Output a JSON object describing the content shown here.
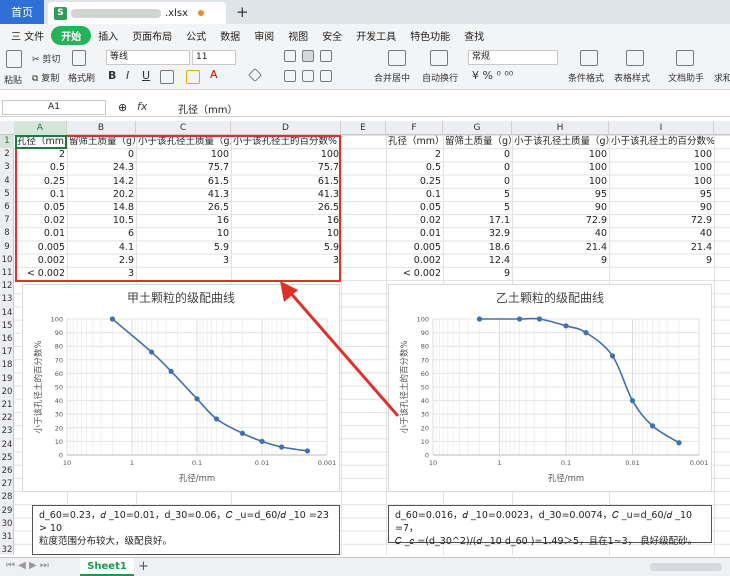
{
  "titlebar": {
    "home": "首页",
    "file_ext": ".xlsx",
    "new_tab": "+"
  },
  "menu": [
    "三 文件",
    "开始",
    "插入",
    "页面布局",
    "公式",
    "数据",
    "审阅",
    "视图",
    "安全",
    "开发工具",
    "特色功能",
    "查找"
  ],
  "ribbon": {
    "cut": "剪切",
    "copy": "复制",
    "paste": "粘贴",
    "format_painter": "格式刷",
    "font": "等线",
    "size": "11",
    "merge": "合并居中",
    "wrap": "自动换行",
    "number_format": "常规",
    "cond_format": "条件格式",
    "table_style": "表格样式",
    "doc_helper": "文档助手",
    "sum": "求和",
    "bold": "B",
    "italic": "I",
    "underline": "U"
  },
  "formula": {
    "cell_ref": "A1",
    "fx": "fx",
    "content": "孔径（mm）"
  },
  "columns": [
    "A",
    "B",
    "C",
    "D",
    "E",
    "F",
    "G",
    "H",
    "I"
  ],
  "rows": [
    "1",
    "2",
    "3",
    "4",
    "5",
    "6",
    "7",
    "8",
    "9",
    "10",
    "11",
    "12",
    "13",
    "14",
    "15",
    "16",
    "17",
    "18",
    "19",
    "20",
    "21",
    "22",
    "23",
    "24",
    "25",
    "26",
    "27",
    "28",
    "29",
    "30",
    "31",
    "32"
  ],
  "table1": {
    "headers": [
      "孔径（mm）",
      "留筛土质量（g）",
      "小于该孔径土质量（g）",
      "小于该孔径土的百分数%"
    ],
    "rows": [
      [
        "2",
        "0",
        "100",
        "100"
      ],
      [
        "0.5",
        "24.3",
        "75.7",
        "75.7"
      ],
      [
        "0.25",
        "14.2",
        "61.5",
        "61.5"
      ],
      [
        "0.1",
        "20.2",
        "41.3",
        "41.3"
      ],
      [
        "0.05",
        "14.8",
        "26.5",
        "26.5"
      ],
      [
        "0.02",
        "10.5",
        "16",
        "16"
      ],
      [
        "0.01",
        "6",
        "10",
        "10"
      ],
      [
        "0.005",
        "4.1",
        "5.9",
        "5.9"
      ],
      [
        "0.002",
        "2.9",
        "3",
        "3"
      ],
      [
        "< 0.002",
        "3",
        "",
        ""
      ]
    ]
  },
  "table2": {
    "headers": [
      "孔径（mm）",
      "留筛土质量（g）",
      "小于该孔径土质量（g）",
      "小于该孔径土的百分数%"
    ],
    "rows": [
      [
        "2",
        "0",
        "100",
        "100"
      ],
      [
        "0.5",
        "0",
        "100",
        "100"
      ],
      [
        "0.25",
        "0",
        "100",
        "100"
      ],
      [
        "0.1",
        "5",
        "95",
        "95"
      ],
      [
        "0.05",
        "5",
        "90",
        "90"
      ],
      [
        "0.02",
        "17.1",
        "72.9",
        "72.9"
      ],
      [
        "0.01",
        "32.9",
        "40",
        "40"
      ],
      [
        "0.005",
        "18.6",
        "21.4",
        "21.4"
      ],
      [
        "0.002",
        "12.4",
        "9",
        "9"
      ],
      [
        "< 0.002",
        "9",
        "",
        ""
      ]
    ]
  },
  "chart_data": [
    {
      "type": "line",
      "title": "甲土颗粒的级配曲线",
      "xlabel": "孔径/mm",
      "ylabel": "小于该孔径土的百分数%",
      "x_scale": "log",
      "x_reversed": true,
      "xlim": [
        10,
        0.001
      ],
      "ylim": [
        0,
        100
      ],
      "x_ticks": [
        "10",
        "1",
        "0.1",
        "0.01",
        "0.001"
      ],
      "y_ticks": [
        "0",
        "10",
        "20",
        "30",
        "40",
        "50",
        "60",
        "70",
        "80",
        "90",
        "100"
      ],
      "x": [
        2,
        0.5,
        0.25,
        0.1,
        0.05,
        0.02,
        0.01,
        0.005,
        0.002
      ],
      "y": [
        100,
        75.7,
        61.5,
        41.3,
        26.5,
        16,
        10,
        5.9,
        3
      ]
    },
    {
      "type": "line",
      "title": "乙土颗粒的级配曲线",
      "xlabel": "孔径/mm",
      "ylabel": "小于该孔径土的百分数%",
      "x_scale": "log",
      "x_reversed": true,
      "xlim": [
        10,
        0.001
      ],
      "ylim": [
        0,
        100
      ],
      "x_ticks": [
        "10",
        "1",
        "0.1",
        "0.01",
        "0.001"
      ],
      "y_ticks": [
        "0",
        "10",
        "20",
        "30",
        "40",
        "50",
        "60",
        "70",
        "80",
        "90",
        "100"
      ],
      "x": [
        2,
        0.5,
        0.25,
        0.1,
        0.05,
        0.02,
        0.01,
        0.005,
        0.002
      ],
      "y": [
        100,
        100,
        100,
        95,
        90,
        72.9,
        40,
        21.4,
        9
      ]
    }
  ],
  "notes": {
    "left": [
      "d_60=0.23，𝑑 _10=0.01，d_30=0.06，𝐶 _u=d_60/𝑑 _10 =23",
      "> 10",
      "粒度范围分布较大，级配良好。"
    ],
    "right": [
      "d_60=0.016，𝑑 _10=0.0023，d_30=0.0074，𝐶 _u=d_60/𝑑 _10 =7，",
      "𝐶 _𝑐 =(d_30^2)/(𝑑 _10 d_60 )=1.49＞5，且在1~3， 良好级配砂。"
    ]
  },
  "sheet": {
    "name": "Sheet1",
    "add": "+"
  },
  "colors": {
    "accent": "#23b35a",
    "red": "#e0302c",
    "line": "#3f6fb5"
  }
}
